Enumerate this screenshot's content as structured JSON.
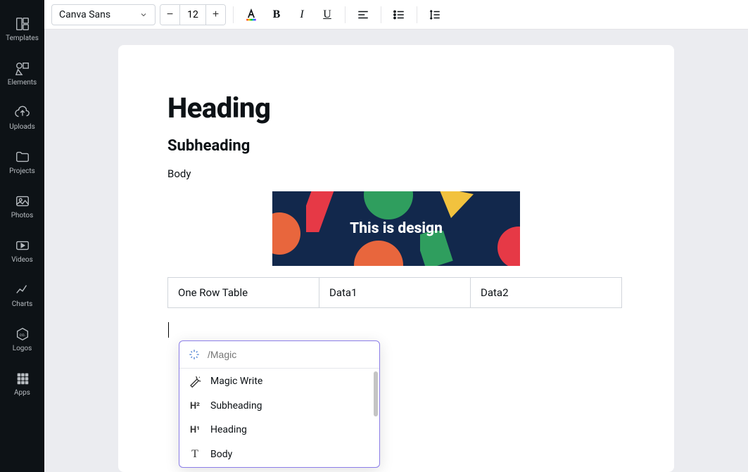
{
  "sidebar": {
    "items": [
      {
        "label": "Templates"
      },
      {
        "label": "Elements"
      },
      {
        "label": "Uploads"
      },
      {
        "label": "Projects"
      },
      {
        "label": "Photos"
      },
      {
        "label": "Videos"
      },
      {
        "label": "Charts"
      },
      {
        "label": "Logos"
      },
      {
        "label": "Apps"
      }
    ]
  },
  "toolbar": {
    "font": "Canva Sans",
    "size": "12",
    "minus": "−",
    "plus": "+"
  },
  "doc": {
    "heading": "Heading",
    "subheading": "Subheading",
    "body": "Body",
    "banner_text": "This is design",
    "table": {
      "c1": "One Row Table",
      "c2": "Data1",
      "c3": "Data2"
    }
  },
  "popup": {
    "placeholder": "/Magic",
    "items": [
      {
        "label": "Magic Write"
      },
      {
        "label": "Subheading"
      },
      {
        "label": "Heading"
      },
      {
        "label": "Body"
      }
    ]
  }
}
